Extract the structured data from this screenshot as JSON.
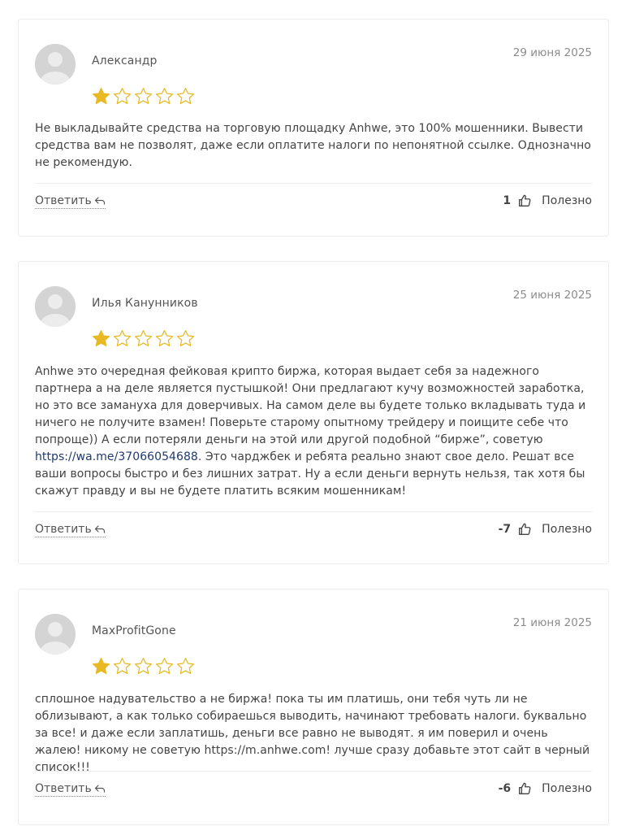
{
  "colors": {
    "star_filled": "#e8b923",
    "star_outline": "#e8b923",
    "link": "#1f3a6e",
    "border": "#ececec"
  },
  "reviews": [
    {
      "author": "Александр",
      "date": "29 июня 2025",
      "rating": 1,
      "text_parts": [
        "Не выкладывайте средства на торговую площадку Anhwe, это 100% мошенники. Вывести средства вам не позволят, даже если оплатите налоги по непонятной ссылке. Однозначно не рекомендую."
      ],
      "reply_label": "Ответить",
      "votes": "1",
      "helpful_label": "Полезно"
    },
    {
      "author": "Илья Канунников",
      "date": "25 июня 2025",
      "rating": 1,
      "text_before_link": "Anhwe это очередная фейковая крипто биржа, которая выдает себя за надежного партнера а на деле является пустышкой! Они предлагают кучу возможностей заработка, но это все замануха для доверчивых. На самом деле вы будете только вкладывать туда и ничего не получите взамен! Поверьте старому опытному трейдеру и поищите себе что попроще)) А если потеряли деньги на этой или другой подобной “бирже”, советую ",
      "link_text": "https://wa.me/37066054688",
      "text_after_link": ". Это чарджбек и ребята реально знают свое дело. Решат все ваши вопросы быстро и без лишних затрат. Ну а если деньги вернуть нельзя, так хотя бы скажут правду и вы не будете платить всяким мошенникам!",
      "reply_label": "Ответить",
      "votes": "-7",
      "helpful_label": "Полезно"
    },
    {
      "author": "MaxProfitGone",
      "date": "21 июня 2025",
      "rating": 1,
      "text_parts": [
        "сплошное надувательство а не биржа! пока ты им платишь, они тебя чуть ли не облизывают, а как только собираешься выводить, начинают требовать налоги. буквально за все! и даже если заплатишь, деньги все равно не выводят. я им поверил и очень жалею! никому не советую https://m.anhwe.com! лучше сразу добавьте этот сайт в черный список!!!"
      ],
      "reply_label": "Ответить",
      "votes": "-6",
      "helpful_label": "Полезно"
    }
  ]
}
